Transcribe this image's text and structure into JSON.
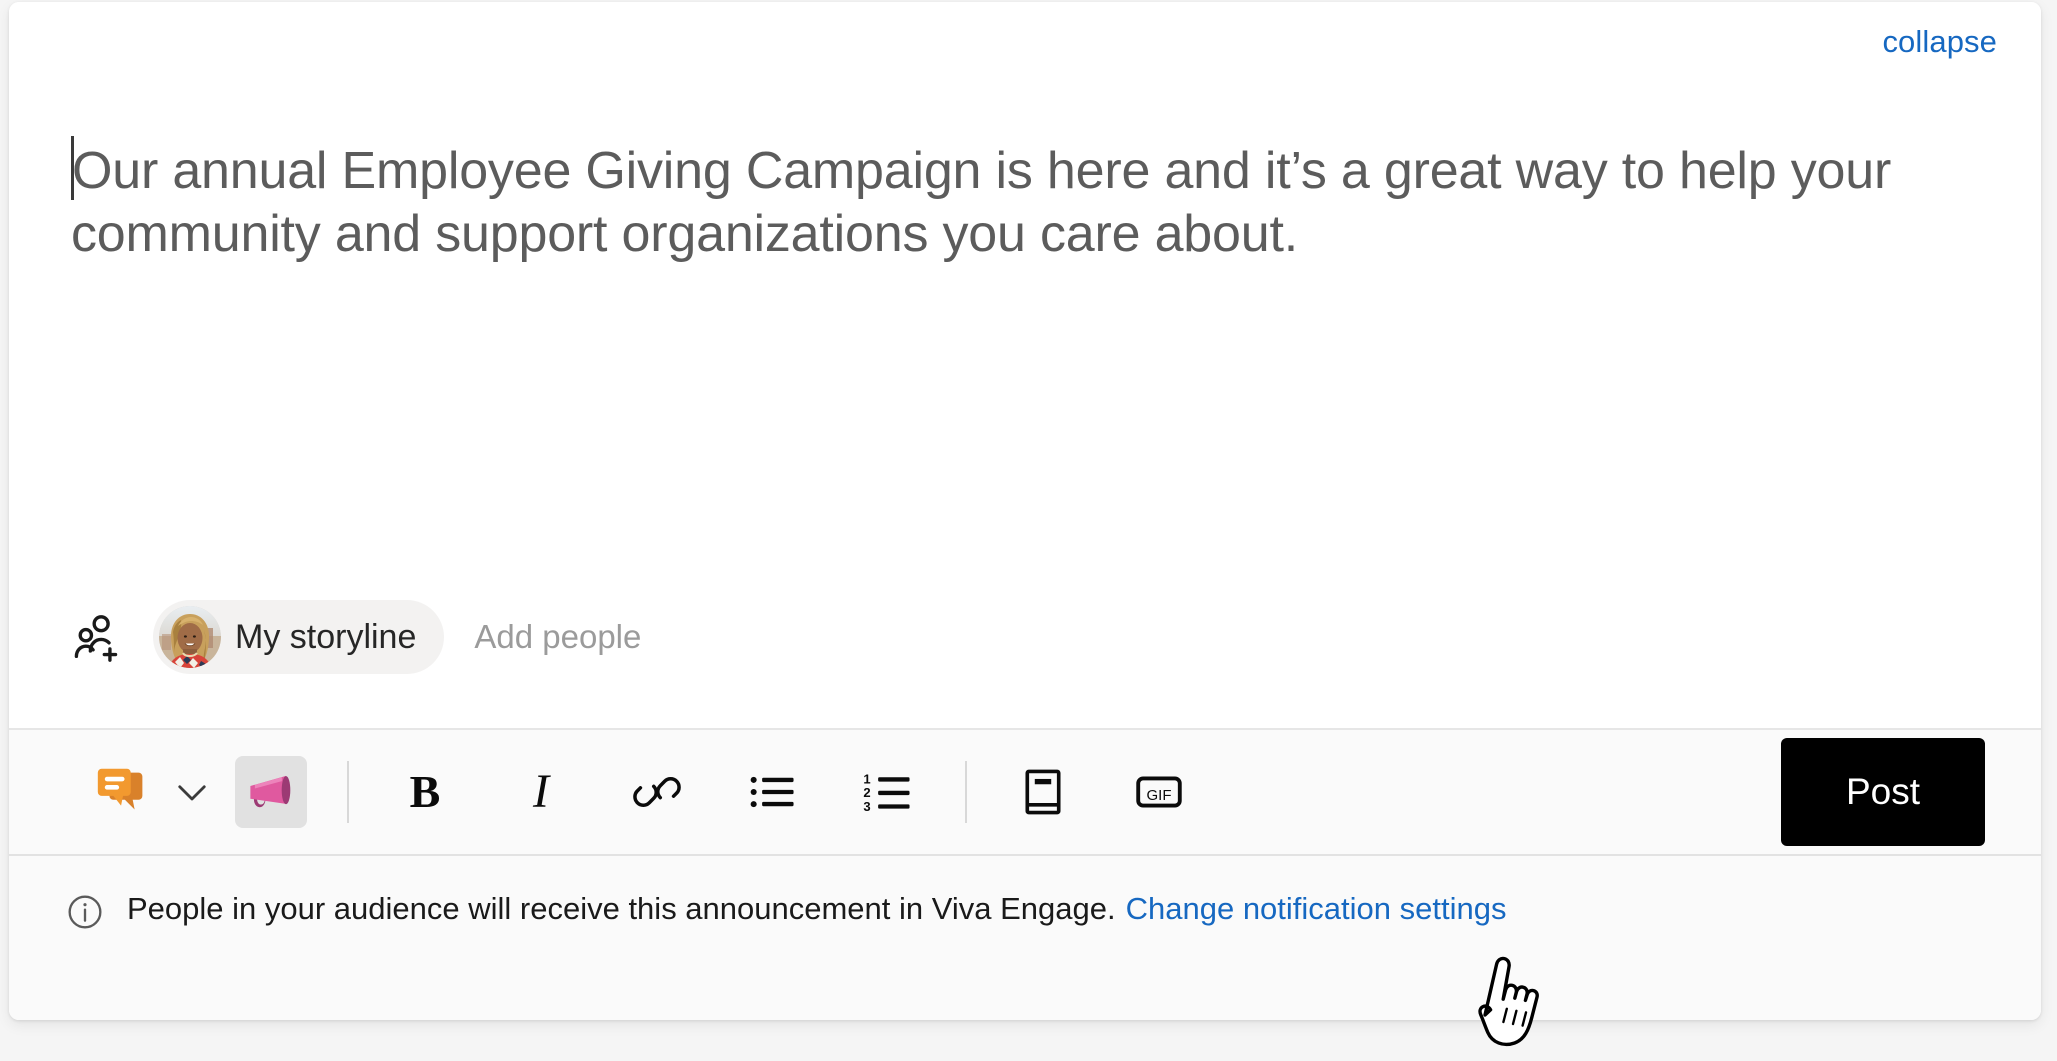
{
  "card": {
    "collapse_label": "collapse"
  },
  "composer": {
    "message_text": "Our annual Employee Giving Campaign is here and it’s a great way to help your community and support organizations you care about.",
    "caret_visible": true
  },
  "audience": {
    "add_audience_icon": "add-people-icon",
    "chip_label": "My storyline",
    "avatar_alt": "user-avatar-photo",
    "placeholder": "Add people"
  },
  "toolbar": {
    "post_type_icon": "discussion-bubble-icon",
    "post_type_chevron_icon": "chevron-down-icon",
    "items": [
      {
        "name": "announcement-button",
        "icon": "megaphone-icon",
        "label": "Announcement",
        "selected": true
      },
      {
        "name": "bold-button",
        "icon": "bold-icon",
        "label": "B",
        "selected": false
      },
      {
        "name": "italic-button",
        "icon": "italic-icon",
        "label": "I",
        "selected": false
      },
      {
        "name": "link-button",
        "icon": "link-icon",
        "label": "Link",
        "selected": false
      },
      {
        "name": "bulleted-list-button",
        "icon": "bulleted-list-icon",
        "label": "Bulleted list",
        "selected": false
      },
      {
        "name": "numbered-list-button",
        "icon": "numbered-list-icon",
        "label": "Numbered list",
        "selected": false
      },
      {
        "name": "praise-button",
        "icon": "book-icon",
        "label": "Praise",
        "selected": false
      },
      {
        "name": "gif-button",
        "icon": "gif-icon",
        "label": "GIF",
        "selected": false
      }
    ],
    "gif_label": "GIF",
    "post_label": "Post"
  },
  "notice": {
    "icon": "info-circle-icon",
    "text": "People in your audience will receive this announcement in Viva Engage.",
    "link_label": "Change notification settings"
  },
  "cursor": {
    "type": "pointing-hand-cursor"
  },
  "colors": {
    "link_blue": "#1668c1",
    "post_button_bg": "#000000",
    "chip_bg": "#f3f2f1",
    "toolbar_bg": "#fafafa",
    "selected_tool_bg": "#e1e1e1",
    "megaphone_pink": "#e0599f",
    "discussion_orange": "#f2962d",
    "message_text": "#5c5c5c"
  }
}
